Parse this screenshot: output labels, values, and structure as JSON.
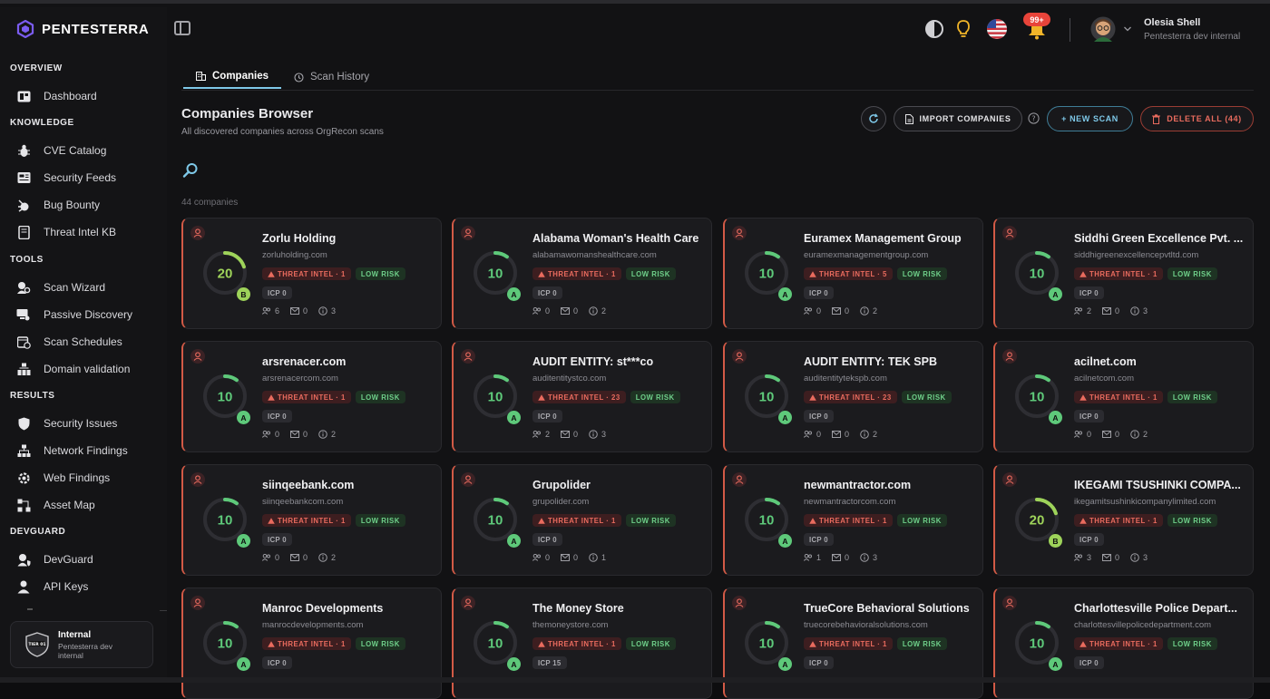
{
  "app": {
    "name": "PENTESTERRA"
  },
  "sidebar": {
    "sections": [
      {
        "label": "OVERVIEW",
        "items": [
          {
            "label": "Dashboard",
            "icon": "dashboard-icon"
          }
        ]
      },
      {
        "label": "KNOWLEDGE",
        "items": [
          {
            "label": "CVE Catalog",
            "icon": "bug-icon"
          },
          {
            "label": "Security Feeds",
            "icon": "feed-icon"
          },
          {
            "label": "Bug Bounty",
            "icon": "bug-bounty-icon"
          },
          {
            "label": "Threat Intel KB",
            "icon": "book-icon"
          }
        ]
      },
      {
        "label": "TOOLS",
        "items": [
          {
            "label": "Scan Wizard",
            "icon": "wizard-icon"
          },
          {
            "label": "Passive Discovery",
            "icon": "discovery-icon"
          },
          {
            "label": "Scan Schedules",
            "icon": "calendar-icon"
          },
          {
            "label": "Domain validation",
            "icon": "domain-icon"
          }
        ]
      },
      {
        "label": "RESULTS",
        "items": [
          {
            "label": "Security Issues",
            "icon": "shield-icon"
          },
          {
            "label": "Network Findings",
            "icon": "network-icon"
          },
          {
            "label": "Web Findings",
            "icon": "web-icon"
          },
          {
            "label": "Asset Map",
            "icon": "map-icon"
          }
        ]
      },
      {
        "label": "DEVGUARD",
        "items": [
          {
            "label": "DevGuard",
            "icon": "devguard-icon"
          },
          {
            "label": "API Keys",
            "icon": "key-icon"
          }
        ]
      }
    ],
    "tenant": {
      "title": "Internal",
      "subtitle": "Pentesterra dev internal",
      "badge": "TIER 01"
    }
  },
  "header": {
    "notifications_badge": "99+",
    "user_name": "Olesia Shell",
    "user_role": "Pentesterra dev internal"
  },
  "tabs": [
    {
      "label": "Companies",
      "active": true
    },
    {
      "label": "Scan History",
      "active": false
    }
  ],
  "page": {
    "title": "Companies Browser",
    "subtitle": "All discovered companies across OrgRecon scans",
    "count_label": "44 companies",
    "import_label": "IMPORT COMPANIES",
    "new_scan_label": "+ NEW SCAN",
    "delete_label": "DELETE ALL (44)"
  },
  "companies": [
    {
      "name": "Zorlu Holding",
      "domain": "zorluholding.com",
      "score": "20",
      "grade": "B",
      "threat": "THREAT INTEL · 1",
      "risk": "LOW RISK",
      "icp": "ICP 0",
      "people": "6",
      "mail": "0",
      "info": "3"
    },
    {
      "name": "Alabama Woman's Health Care",
      "domain": "alabamawomanshealthcare.com",
      "score": "10",
      "grade": "A",
      "threat": "THREAT INTEL · 1",
      "risk": "LOW RISK",
      "icp": "ICP 0",
      "people": "0",
      "mail": "0",
      "info": "2"
    },
    {
      "name": "Euramex Management Group",
      "domain": "euramexmanagementgroup.com",
      "score": "10",
      "grade": "A",
      "threat": "THREAT INTEL · 5",
      "risk": "LOW RISK",
      "icp": "ICP 0",
      "people": "0",
      "mail": "0",
      "info": "2"
    },
    {
      "name": "Siddhi Green Excellence Pvt. ...",
      "domain": "siddhigreenexcellencepvtltd.com",
      "score": "10",
      "grade": "A",
      "threat": "THREAT INTEL · 1",
      "risk": "LOW RISK",
      "icp": "ICP 0",
      "people": "2",
      "mail": "0",
      "info": "3"
    },
    {
      "name": "arsrenacer.com",
      "domain": "arsrenacercom.com",
      "score": "10",
      "grade": "A",
      "threat": "THREAT INTEL · 1",
      "risk": "LOW RISK",
      "icp": "ICP 0",
      "people": "0",
      "mail": "0",
      "info": "2"
    },
    {
      "name": "AUDIT ENTITY: st***co",
      "domain": "auditentitystco.com",
      "score": "10",
      "grade": "A",
      "threat": "THREAT INTEL · 23",
      "risk": "LOW RISK",
      "icp": "ICP 0",
      "people": "2",
      "mail": "0",
      "info": "3"
    },
    {
      "name": "AUDIT ENTITY: TEK SPB",
      "domain": "auditentitytekspb.com",
      "score": "10",
      "grade": "A",
      "threat": "THREAT INTEL · 23",
      "risk": "LOW RISK",
      "icp": "ICP 0",
      "people": "0",
      "mail": "0",
      "info": "2"
    },
    {
      "name": "acilnet.com",
      "domain": "acilnetcom.com",
      "score": "10",
      "grade": "A",
      "threat": "THREAT INTEL · 1",
      "risk": "LOW RISK",
      "icp": "ICP 0",
      "people": "0",
      "mail": "0",
      "info": "2"
    },
    {
      "name": "siinqeebank.com",
      "domain": "siinqeebankcom.com",
      "score": "10",
      "grade": "A",
      "threat": "THREAT INTEL · 1",
      "risk": "LOW RISK",
      "icp": "ICP 0",
      "people": "0",
      "mail": "0",
      "info": "2"
    },
    {
      "name": "Grupolider",
      "domain": "grupolider.com",
      "score": "10",
      "grade": "A",
      "threat": "THREAT INTEL · 1",
      "risk": "LOW RISK",
      "icp": "ICP 0",
      "people": "0",
      "mail": "0",
      "info": "1"
    },
    {
      "name": "newmantractor.com",
      "domain": "newmantractorcom.com",
      "score": "10",
      "grade": "A",
      "threat": "THREAT INTEL · 1",
      "risk": "LOW RISK",
      "icp": "ICP 0",
      "people": "1",
      "mail": "0",
      "info": "3"
    },
    {
      "name": "IKEGAMI TSUSHINKI COMPA...",
      "domain": "ikegamitsushinkicompanylimited.com",
      "score": "20",
      "grade": "B",
      "threat": "THREAT INTEL · 1",
      "risk": "LOW RISK",
      "icp": "ICP 0",
      "people": "3",
      "mail": "0",
      "info": "3"
    },
    {
      "name": "Manroc Developments",
      "domain": "manrocdevelopments.com",
      "score": "10",
      "grade": "A",
      "threat": "THREAT INTEL · 1",
      "risk": "LOW RISK",
      "icp": "ICP 0",
      "people": "",
      "mail": "",
      "info": ""
    },
    {
      "name": "The Money Store",
      "domain": "themoneystore.com",
      "score": "10",
      "grade": "A",
      "threat": "THREAT INTEL · 1",
      "risk": "LOW RISK",
      "icp": "ICP 15",
      "people": "",
      "mail": "",
      "info": ""
    },
    {
      "name": "TrueCore Behavioral Solutions",
      "domain": "truecorebehavioralsolutions.com",
      "score": "10",
      "grade": "A",
      "threat": "THREAT INTEL · 1",
      "risk": "LOW RISK",
      "icp": "ICP 0",
      "people": "",
      "mail": "",
      "info": ""
    },
    {
      "name": "Charlottesville Police Depart...",
      "domain": "charlottesvillepolicedepartment.com",
      "score": "10",
      "grade": "A",
      "threat": "THREAT INTEL · 1",
      "risk": "LOW RISK",
      "icp": "ICP 0",
      "people": "",
      "mail": "",
      "info": ""
    }
  ],
  "colors": {
    "accent": "#7ec8e8",
    "danger": "#e96b5e",
    "success": "#6fd08a",
    "grade_a": "#5ec97a",
    "grade_b": "#9ed35a"
  }
}
